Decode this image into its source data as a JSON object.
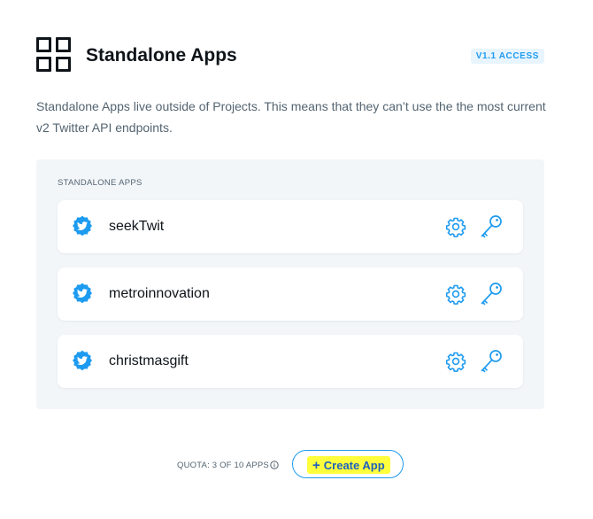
{
  "header": {
    "title": "Standalone Apps",
    "badge": "V1.1 ACCESS"
  },
  "description": "Standalone Apps live outside of Projects. This means that they can’t use the the most current v2 Twitter API endpoints.",
  "panel": {
    "label": "STANDALONE APPS",
    "apps": [
      {
        "name": "seekTwit"
      },
      {
        "name": "metroinnovation"
      },
      {
        "name": "christmasgift"
      }
    ]
  },
  "footer": {
    "quota": "QUOTA: 3 OF 10 APPS",
    "create_label": "Create App"
  },
  "icons": {
    "header": "dashboard-grid-icon",
    "app": "twitter-bird-badge-icon",
    "settings": "gear-icon",
    "keys": "key-icon",
    "info": "info-icon",
    "create": "plus-icon"
  },
  "colors": {
    "accent": "#1d9bf0",
    "highlight": "#ffff3d",
    "panel_bg": "#f3f6f9"
  }
}
